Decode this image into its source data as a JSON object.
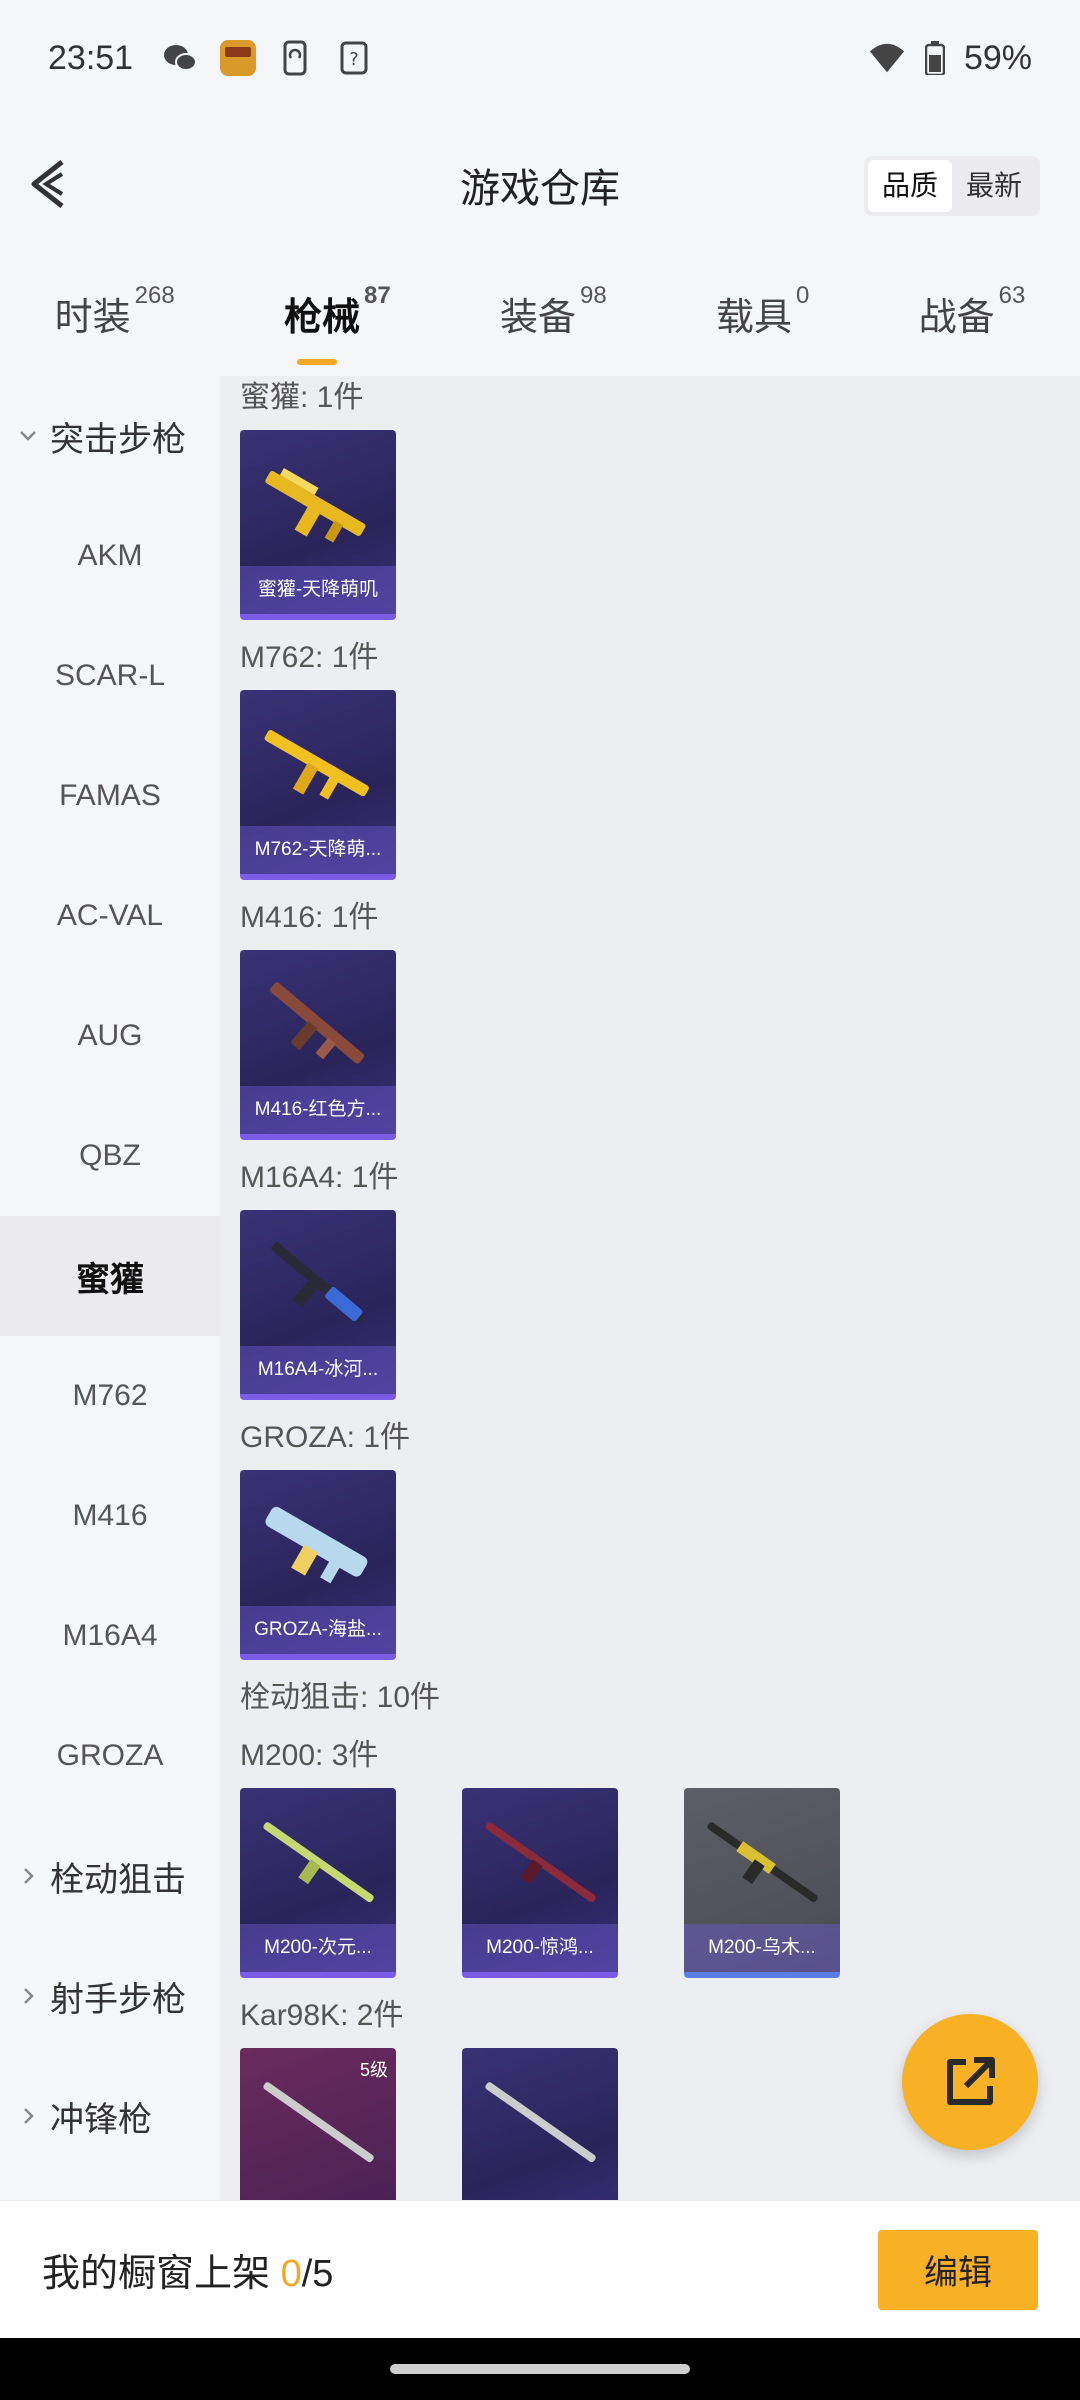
{
  "status_bar": {
    "time": "23:51",
    "battery": "59%",
    "icons": [
      "wechat-icon",
      "game-app-icon",
      "phone-sync-icon",
      "help-icon",
      "wifi-icon",
      "battery-icon"
    ]
  },
  "header": {
    "title": "游戏仓库",
    "sort_options": [
      "品质",
      "最新"
    ],
    "sort_selected": "品质"
  },
  "tabs": [
    {
      "label": "时装",
      "count": "268"
    },
    {
      "label": "枪械",
      "count": "87",
      "active": true
    },
    {
      "label": "装备",
      "count": "98"
    },
    {
      "label": "载具",
      "count": "0"
    },
    {
      "label": "战备",
      "count": "63"
    }
  ],
  "sidebar": {
    "items": [
      {
        "label": "突击步枪",
        "type": "group",
        "expanded": true
      },
      {
        "label": "AKM"
      },
      {
        "label": "SCAR-L"
      },
      {
        "label": "FAMAS"
      },
      {
        "label": "AC-VAL"
      },
      {
        "label": "AUG"
      },
      {
        "label": "QBZ"
      },
      {
        "label": "蜜獾",
        "active": true
      },
      {
        "label": "M762"
      },
      {
        "label": "M416"
      },
      {
        "label": "M16A4"
      },
      {
        "label": "GROZA"
      },
      {
        "label": "栓动狙击",
        "type": "group"
      },
      {
        "label": "射手步枪",
        "type": "group"
      },
      {
        "label": "冲锋枪",
        "type": "group"
      }
    ]
  },
  "sections": [
    {
      "title": "蜜獾: 1件",
      "cards": [
        {
          "label": "蜜獾-天降萌叽",
          "gun_color": "#e8b820"
        }
      ]
    },
    {
      "title": "M762: 1件",
      "cards": [
        {
          "label": "M762-天降萌...",
          "gun_color": "#f0c020"
        }
      ]
    },
    {
      "title": "M416: 1件",
      "cards": [
        {
          "label": "M416-红色方...",
          "gun_color": "#8a4a3a"
        }
      ]
    },
    {
      "title": "M16A4: 1件",
      "cards": [
        {
          "label": "M16A4-冰河...",
          "gun_color": "#3a6ad8"
        }
      ]
    },
    {
      "title": "GROZA: 1件",
      "cards": [
        {
          "label": "GROZA-海盐...",
          "gun_color": "#b8d8f0"
        }
      ]
    },
    {
      "title": "栓动狙击: 10件",
      "cards": []
    },
    {
      "title": "M200: 3件",
      "cards": [
        {
          "label": "M200-次元...",
          "gun_color": "#c8d870"
        },
        {
          "label": "M200-惊鸿...",
          "gun_color": "#8a2a3a"
        },
        {
          "label": "M200-乌木...",
          "gun_color": "#d8c030",
          "style": "gray"
        }
      ]
    },
    {
      "title": "Kar98K: 2件",
      "cards": [
        {
          "label": "",
          "level": "5级",
          "gun_color": "#cccccc",
          "style": "pink"
        },
        {
          "label": "",
          "gun_color": "#cccccc"
        }
      ]
    }
  ],
  "bottom_bar": {
    "label": "我的橱窗上架 ",
    "current": "0",
    "total": "/5",
    "edit_label": "编辑"
  },
  "colors": {
    "accent": "#f8b024",
    "card_purple": "#2a245a",
    "card_border": "#7a5ce6"
  }
}
